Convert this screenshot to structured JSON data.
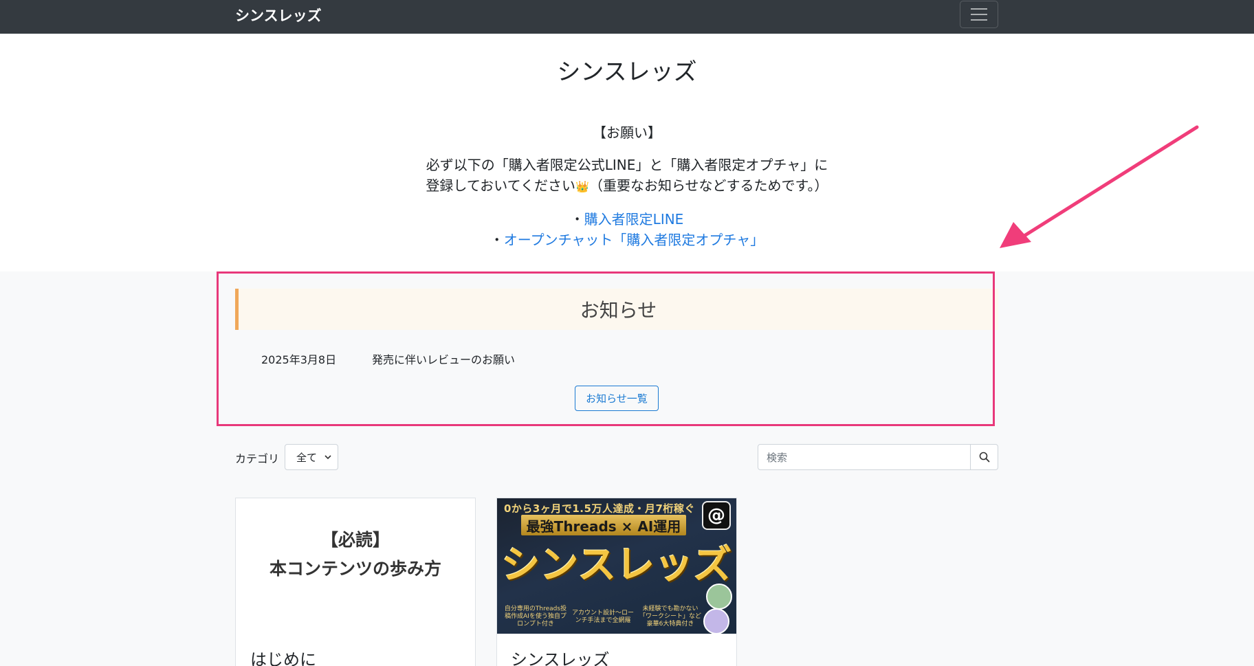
{
  "navbar": {
    "brand": "シンスレッズ",
    "toggle_icon": "hamburger-menu-icon"
  },
  "header": {
    "title": "シンスレッズ",
    "notice_heading": "【お願い】",
    "notice_line1": "必ず以下の「購入者限定公式LINE」と「購入者限定オプチャ」に",
    "notice_line2_pre": "登録しておいてください",
    "notice_line2_post": "（重要なお知らせなどするためです。）",
    "links": [
      {
        "prefix": "・",
        "label": "購入者限定LINE"
      },
      {
        "prefix": "・",
        "label": "オープンチャット「購入者限定オプチャ」"
      }
    ]
  },
  "news": {
    "title": "お知らせ",
    "items": [
      {
        "date": "2025年3月8日",
        "text": "発売に伴いレビューのお願い"
      }
    ],
    "all_button": "お知らせ一覧"
  },
  "filter": {
    "category_label": "カテゴリ",
    "category_value": "全て",
    "search_placeholder": "検索"
  },
  "cards": [
    {
      "banner_line1": "【必読】",
      "banner_line2": "本コンテンツの歩み方",
      "title": "はじめに"
    },
    {
      "thumb_top": "0から3ヶ月で1.5万人達成・月7桁稼ぐ",
      "thumb_mid": "最強Threads × AI運用",
      "thumb_big": "シンスレッズ",
      "thumb_badges": [
        "自分専用のThreads投稿作成AIを使う独自プロンプト付き",
        "アカウント設計〜ローンチ手法まで全網羅",
        "未経験でも勘かない「ワークシート」など豪華6大特典付き"
      ],
      "title": "シンスレッズ"
    }
  ],
  "colors": {
    "navbar": "#343a40",
    "link": "#1f7ae0",
    "highlight": "#e8387a",
    "news_accent": "#f0a85a",
    "button": "#1a7ad2"
  }
}
